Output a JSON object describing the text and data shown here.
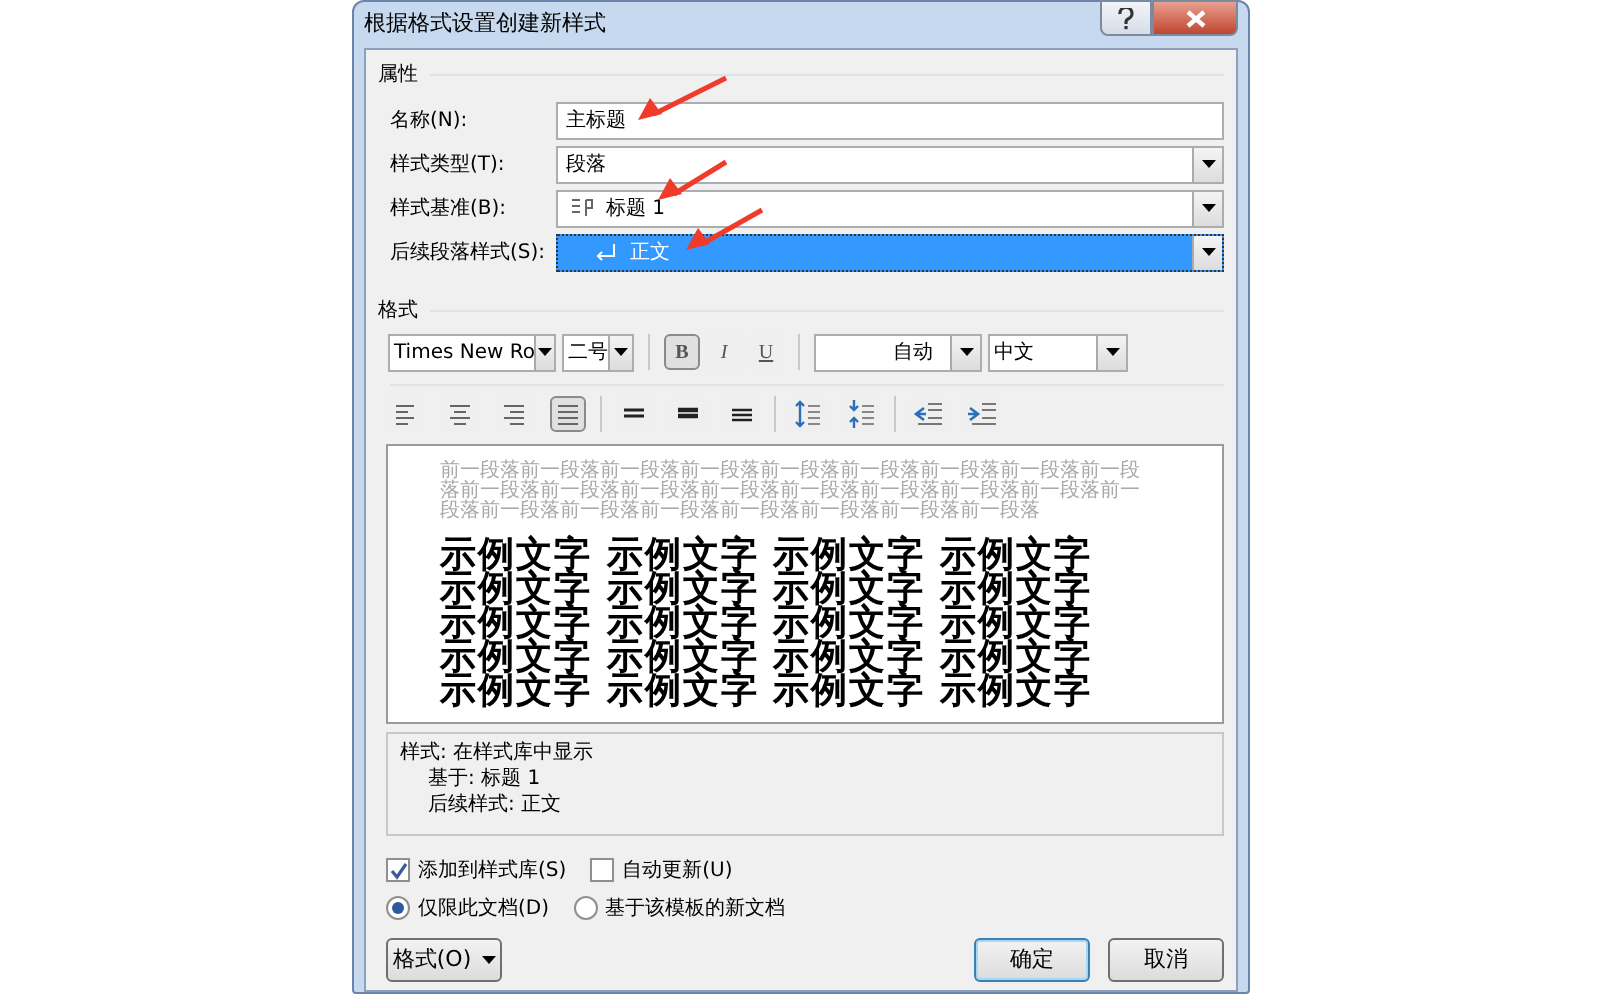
{
  "window": {
    "title": "根据格式设置创建新样式"
  },
  "properties": {
    "title": "属性",
    "fields": [
      {
        "label": "名称(N):",
        "kind": "text",
        "value": "主标题",
        "selected": false
      },
      {
        "label": "样式类型(T):",
        "kind": "select",
        "value": "段落",
        "selected": false
      },
      {
        "label": "样式基准(B):",
        "kind": "paragraph_style",
        "value": "标题 1",
        "selected": false
      },
      {
        "label": "后续段落样式(S):",
        "kind": "next_style",
        "value": "正文",
        "selected": true
      }
    ]
  },
  "format": {
    "title": "格式",
    "font": "Times New Ro",
    "size": "二号",
    "styles": [
      {
        "label": "B",
        "kind": "bold",
        "selected": true
      },
      {
        "label": "I",
        "kind": "italic",
        "selected": false
      },
      {
        "label": "U",
        "kind": "underline",
        "selected": false
      }
    ],
    "color_setting": "自动",
    "script": "中文",
    "alignment": [
      {
        "kind": "left",
        "selected": false
      },
      {
        "kind": "center",
        "selected": false
      },
      {
        "kind": "right",
        "selected": false
      },
      {
        "kind": "justify",
        "selected": true
      }
    ],
    "line_spacing": [
      {
        "kind": "single",
        "selected": false
      },
      {
        "kind": "onehalf",
        "selected": false
      },
      {
        "kind": "double",
        "selected": false
      }
    ],
    "paragraph_spacing": [
      {
        "kind": "increase",
        "selected": false
      },
      {
        "kind": "decrease",
        "selected": false
      }
    ],
    "indent": [
      {
        "kind": "decrease",
        "selected": false
      },
      {
        "kind": "increase",
        "selected": false
      }
    ]
  },
  "preview": {
    "previous_paragraph": "前一段落前一段落前一段落前一段落前一段落前一段落前一段落前一段落前一段落前一段落前一段落前一段落前一段落前一段落前一段落前一段落前一段落前一段落前一段落前一段落前一段落前一段落前一段落前一段落前一段落",
    "sample_lines": [
      "示例文字 示例文字 示例文字 示例文字",
      "示例文字 示例文字 示例文字 示例文字",
      "示例文字 示例文字 示例文字 示例文字",
      "示例文字 示例文字 示例文字 示例文字",
      "示例文字 示例文字 示例文字 示例文字"
    ]
  },
  "description": [
    {
      "text": "样式: 在样式库中显示",
      "children": [
        {
          "text": "基于: 标题 1"
        },
        {
          "text": "后续样式: 正文"
        }
      ]
    }
  ],
  "options": {
    "checkboxes": [
      {
        "label": "添加到样式库(S)",
        "checked": true
      },
      {
        "label": "自动更新(U)",
        "checked": false
      }
    ],
    "radios": [
      {
        "label": "仅限此文档(D)",
        "selected": true
      },
      {
        "label": "基于该模板的新文档",
        "selected": false
      }
    ]
  },
  "buttons": {
    "format": "格式(O)",
    "ok": "确定",
    "cancel": "取消"
  }
}
